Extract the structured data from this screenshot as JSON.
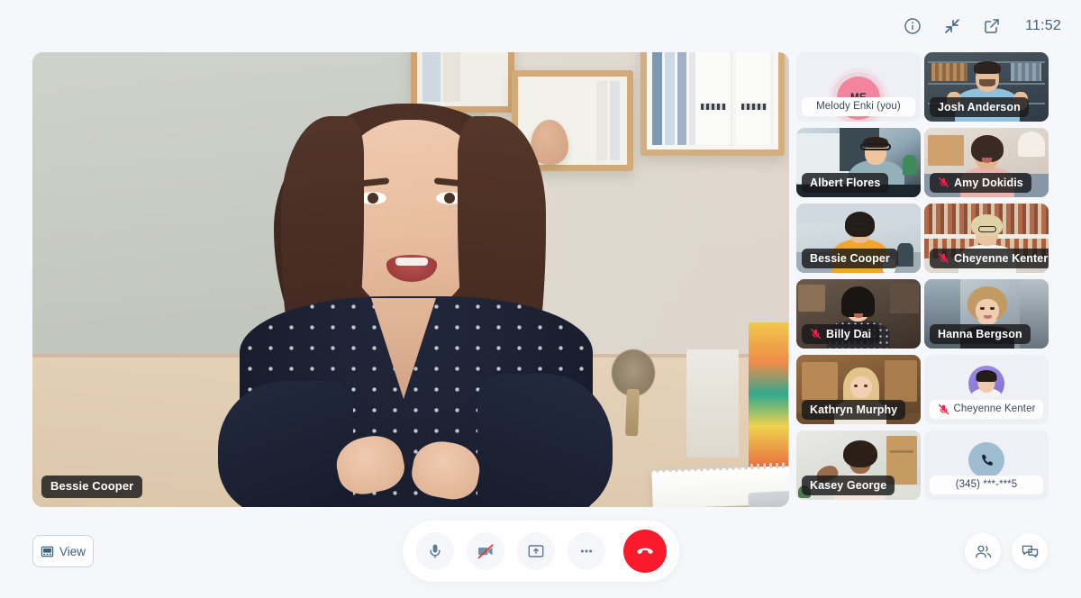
{
  "topbar": {
    "info_icon": "info-circle-icon",
    "minimize_icon": "collapse-arrows-icon",
    "popout_icon": "external-link-icon",
    "time": "11:52"
  },
  "main_stage": {
    "speaker_name": "Bessie Cooper",
    "muted": false
  },
  "participants": [
    {
      "name": "Melody Enki (you)",
      "type": "self",
      "initials": "ME",
      "muted": false,
      "avatar_color": "#f4839d"
    },
    {
      "name": "Josh Anderson",
      "type": "video",
      "muted": false
    },
    {
      "name": "Albert Flores",
      "type": "video",
      "muted": false
    },
    {
      "name": "Amy Dokidis",
      "type": "video",
      "muted": true
    },
    {
      "name": "Bessie Cooper",
      "type": "video",
      "muted": false
    },
    {
      "name": "Cheyenne Kenter",
      "type": "video",
      "muted": true
    },
    {
      "name": "Billy Dai",
      "type": "video",
      "muted": true
    },
    {
      "name": "Hanna Bergson",
      "type": "video",
      "muted": false
    },
    {
      "name": "Kathryn Murphy",
      "type": "video",
      "muted": false
    },
    {
      "name": "Cheyenne Kenter",
      "type": "avatar",
      "muted": true
    },
    {
      "name": "Kasey George",
      "type": "video",
      "muted": false
    },
    {
      "name": "(345) ***-***5",
      "type": "phone",
      "muted": false
    }
  ],
  "bottom_bar": {
    "view_label": "View",
    "view_icon": "layout-grid-icon",
    "mic_icon": "microphone-icon",
    "camera_icon": "camera-off-icon",
    "share_icon": "screen-share-icon",
    "more_icon": "more-options-icon",
    "end_call_icon": "end-call-icon",
    "participants_icon": "participants-icon",
    "chat_icon": "chat-icon"
  },
  "colors": {
    "page_bg": "#f6f7fa",
    "end_call_red": "#f91b2c",
    "mute_red": "#e8274b",
    "accent_blue": "#4a6b85",
    "self_avatar_pink": "#f4839d"
  }
}
